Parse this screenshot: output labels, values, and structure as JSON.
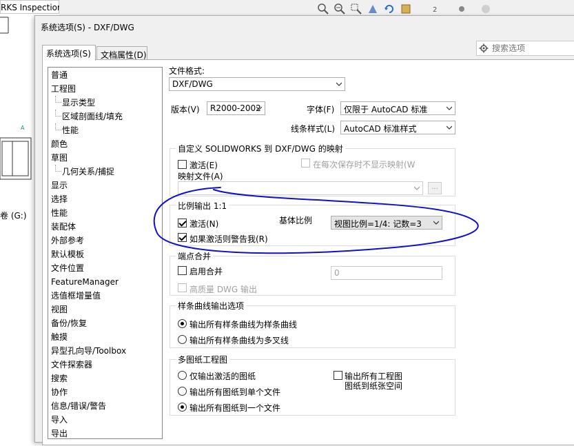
{
  "background": {
    "app_title": "RKS Inspection",
    "drive_label": "卷 (G:)"
  },
  "dialog": {
    "title": "系统选项(S) - DXF/DWG",
    "tabs": [
      {
        "label": "系统选项(S)",
        "active": true
      },
      {
        "label": "文档属性(D)",
        "active": false
      }
    ],
    "search": {
      "placeholder": "搜索选项"
    }
  },
  "tree": {
    "items": [
      {
        "label": "普通",
        "level": 0
      },
      {
        "label": "工程图",
        "level": 0
      },
      {
        "label": "显示类型",
        "level": 1
      },
      {
        "label": "区域剖面线/填充",
        "level": 1
      },
      {
        "label": "性能",
        "level": 1
      },
      {
        "label": "颜色",
        "level": 0
      },
      {
        "label": "草图",
        "level": 0
      },
      {
        "label": "几何关系/捕捉",
        "level": 1
      },
      {
        "label": "显示",
        "level": 0
      },
      {
        "label": "选择",
        "level": 0
      },
      {
        "label": "性能",
        "level": 0
      },
      {
        "label": "装配体",
        "level": 0
      },
      {
        "label": "外部参考",
        "level": 0
      },
      {
        "label": "默认模板",
        "level": 0
      },
      {
        "label": "文件位置",
        "level": 0
      },
      {
        "label": "FeatureManager",
        "level": 0
      },
      {
        "label": "选值框增量值",
        "level": 0
      },
      {
        "label": "视图",
        "level": 0
      },
      {
        "label": "备份/恢复",
        "level": 0
      },
      {
        "label": "触摸",
        "level": 0
      },
      {
        "label": "异型孔向导/Toolbox",
        "level": 0
      },
      {
        "label": "文件探索器",
        "level": 0
      },
      {
        "label": "搜索",
        "level": 0
      },
      {
        "label": "协作",
        "level": 0
      },
      {
        "label": "信息/错误/警告",
        "level": 0
      },
      {
        "label": "导入",
        "level": 0
      },
      {
        "label": "导出",
        "level": 0
      }
    ]
  },
  "panel": {
    "file_format": {
      "label": "文件格式:",
      "value": "DXF/DWG"
    },
    "version": {
      "label": "版本(V)",
      "value": "R2000-2002"
    },
    "font": {
      "label": "字体(F)",
      "value": "仅限于 AutoCAD 标准"
    },
    "line_style": {
      "label": "线条样式(L)",
      "value": "AutoCAD 标准样式"
    },
    "mapping": {
      "title": "自定义 SOLIDWORKS 到 DXF/DWG 的映射",
      "activate": {
        "label": "激活(E)",
        "checked": false
      },
      "no_show_on_save": {
        "label": "在每次保存时不显示映射(W",
        "checked": false
      },
      "map_file_label": "映射文件(A)",
      "map_file_value": "",
      "browse": "..."
    },
    "scale": {
      "title": "比例输出 1:1",
      "activate": {
        "label": "激活(N)",
        "checked": true
      },
      "base_scale_label": "基体比例",
      "base_scale_value": "视图比例=1/4: 记数=3",
      "warn": {
        "label": "如果激活则警告我(R)",
        "checked": true
      }
    },
    "merge": {
      "title": "端点合并",
      "enable": {
        "label": "启用合并",
        "checked": false
      },
      "value": "0",
      "hq": {
        "label": "高质量 DWG 输出",
        "checked": false
      }
    },
    "spline": {
      "title": "样条曲线输出选项",
      "options": [
        {
          "label": "输出所有样条曲线为样条曲线",
          "checked": true
        },
        {
          "label": "输出所有样条曲线为多叉线",
          "checked": false
        }
      ]
    },
    "multi": {
      "title": "多图纸工程图",
      "options": [
        {
          "label": "仅输出激活的图纸",
          "checked": false
        },
        {
          "label": "输出所有图纸到单个文件",
          "checked": false
        },
        {
          "label": "输出所有图纸到一个文件",
          "checked": true
        }
      ],
      "paper_space_line1": "输出所有工程图",
      "paper_space_line2": "图纸到纸张空间"
    }
  },
  "colors": {
    "annotation": "#1010c8",
    "dialog_bg": "#f0f0f0"
  }
}
